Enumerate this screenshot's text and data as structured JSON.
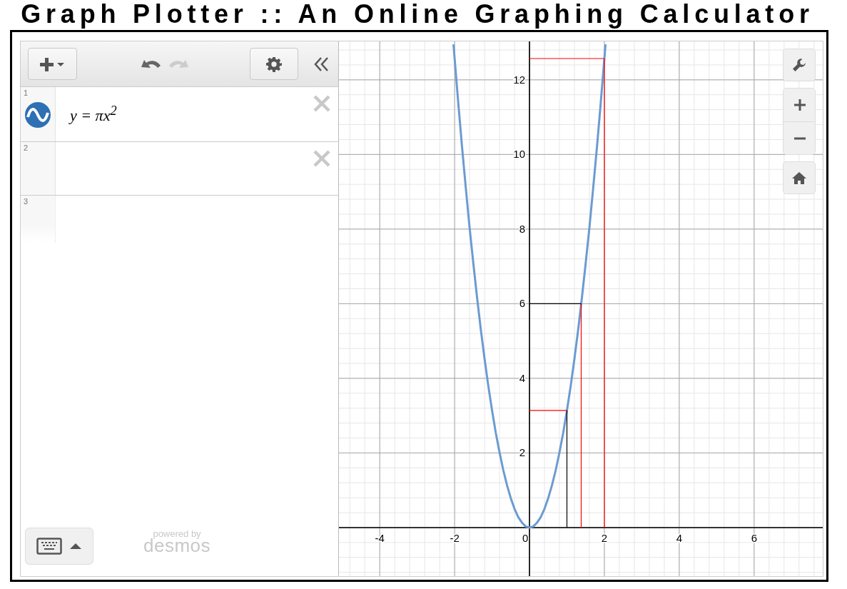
{
  "page_title": "Graph Plotter :: An Online Graphing Calculator",
  "toolbar": {
    "undo_disabled": false,
    "redo_disabled": true
  },
  "expressions": [
    {
      "number": "1",
      "expression": "y = πx$^{2}$",
      "color": "#2d70b3",
      "deletable": true
    },
    {
      "number": "2",
      "deletable": true
    },
    {
      "number": "3",
      "deletable": false
    }
  ],
  "branding": {
    "powered_by": "powered by",
    "name": "desmos"
  },
  "graph": {
    "chart_data": {
      "type": "line",
      "xlim": [
        -5.09,
        7.89
      ],
      "ylim": [
        -1.34,
        13.03
      ],
      "xticks": [
        -4,
        -2,
        0,
        2,
        4,
        6
      ],
      "yticks": [
        2,
        4,
        6,
        8,
        10,
        12
      ],
      "x": [
        -2.03,
        -1.9,
        -1.8,
        -1.7,
        -1.6,
        -1.5,
        -1.4,
        -1.3,
        -1.2,
        -1.1,
        -1.0,
        -0.9,
        -0.8,
        -0.7,
        -0.6,
        -0.5,
        -0.4,
        -0.3,
        -0.2,
        -0.1,
        0,
        0.1,
        0.2,
        0.3,
        0.4,
        0.5,
        0.6,
        0.7,
        0.8,
        0.9,
        1.0,
        1.1,
        1.2,
        1.3,
        1.4,
        1.5,
        1.6,
        1.7,
        1.8,
        1.9,
        2.03
      ],
      "series": [
        {
          "color": "#6b9bd1",
          "values": [
            12.95,
            11.34,
            10.18,
            9.08,
            8.04,
            7.07,
            6.16,
            5.31,
            4.52,
            3.8,
            3.14,
            2.54,
            2.01,
            1.54,
            1.13,
            0.79,
            0.5,
            0.28,
            0.13,
            0.03,
            0,
            0.03,
            0.13,
            0.28,
            0.5,
            0.79,
            1.13,
            1.54,
            2.01,
            2.54,
            3.14,
            3.8,
            4.52,
            5.31,
            6.16,
            7.07,
            8.04,
            9.08,
            10.18,
            11.34,
            12.95
          ]
        },
        {
          "color": "#000000",
          "x": [
            1,
            1
          ],
          "values": [
            0,
            3.14
          ]
        },
        {
          "color": "#ff0000",
          "x": [
            0,
            1
          ],
          "values": [
            3.14,
            3.14
          ]
        },
        {
          "color": "#ff0000",
          "x": [
            1.38,
            1.38
          ],
          "values": [
            0,
            6
          ]
        },
        {
          "color": "#000000",
          "x": [
            0,
            1.38
          ],
          "values": [
            6,
            6
          ]
        },
        {
          "color": "#ff0000",
          "x": [
            2,
            2
          ],
          "values": [
            0,
            12.57
          ]
        },
        {
          "color": "#ff0000",
          "x": [
            0,
            2
          ],
          "values": [
            12.57,
            12.57
          ]
        }
      ],
      "grid": true
    }
  }
}
